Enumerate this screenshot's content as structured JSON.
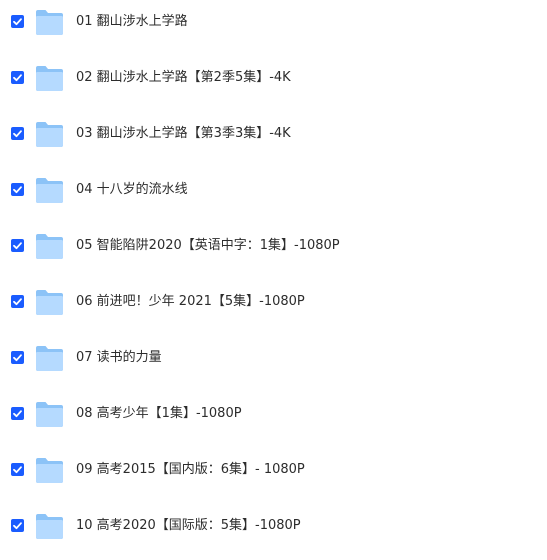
{
  "files": [
    {
      "name": "01 翻山涉水上学路",
      "checked": true,
      "icon": "folder-icon"
    },
    {
      "name": "02 翻山涉水上学路【第2季5集】-4K",
      "checked": true,
      "icon": "folder-icon"
    },
    {
      "name": "03 翻山涉水上学路【第3季3集】-4K",
      "checked": true,
      "icon": "folder-icon"
    },
    {
      "name": "04 十八岁的流水线",
      "checked": true,
      "icon": "folder-icon"
    },
    {
      "name": "05 智能陷阱2020【英语中字：1集】-1080P",
      "checked": true,
      "icon": "folder-icon"
    },
    {
      "name": "06 前进吧！少年 2021【5集】-1080P",
      "checked": true,
      "icon": "folder-icon"
    },
    {
      "name": "07 读书的力量",
      "checked": true,
      "icon": "folder-icon"
    },
    {
      "name": "08 高考少年【1集】-1080P",
      "checked": true,
      "icon": "folder-icon"
    },
    {
      "name": "09 高考2015【国内版：6集】- 1080P",
      "checked": true,
      "icon": "folder-icon"
    },
    {
      "name": "10 高考2020【国际版：5集】-1080P",
      "checked": true,
      "icon": "folder-icon"
    }
  ],
  "colors": {
    "checkbox": "#1a5cff",
    "folder_back": "#8cc3f7",
    "folder_front": "#b5daff",
    "text": "#2c2c2c"
  }
}
